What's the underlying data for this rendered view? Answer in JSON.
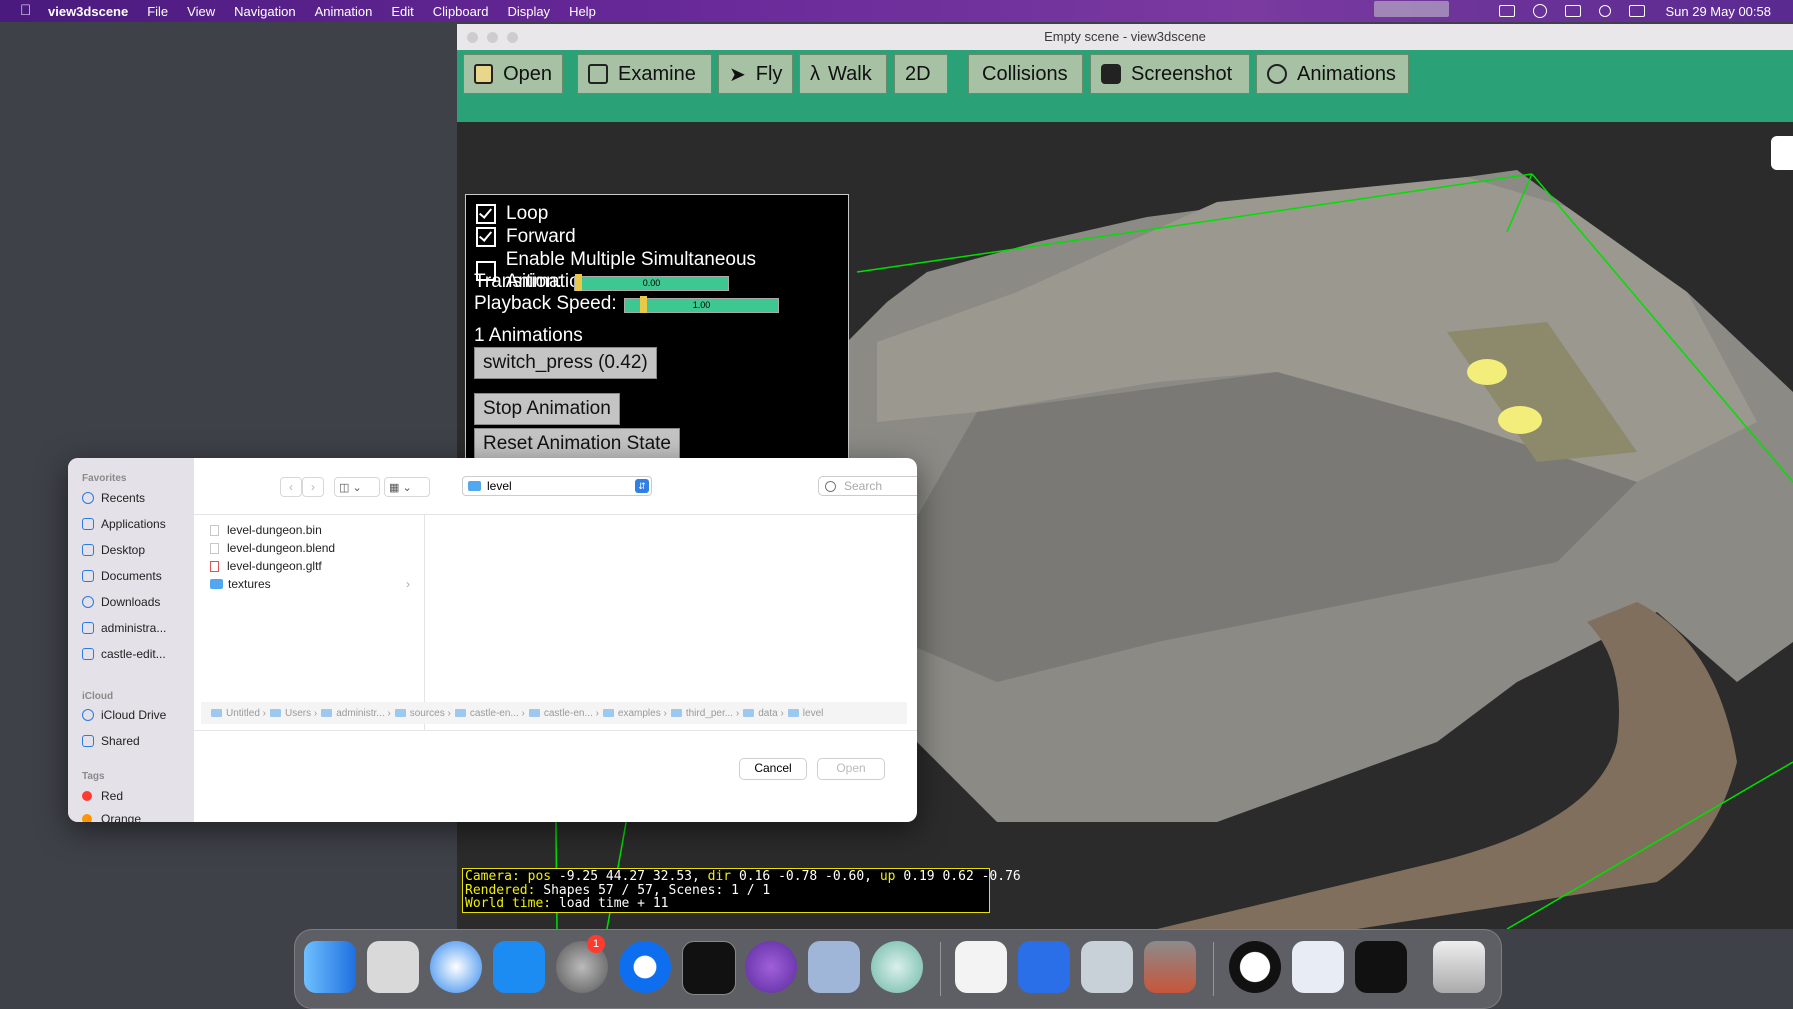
{
  "menubar": {
    "app": "view3dscene",
    "items": [
      "File",
      "View",
      "Navigation",
      "Animation",
      "Edit",
      "Clipboard",
      "Display",
      "Help"
    ],
    "clock": "Sun 29 May  00:58"
  },
  "window": {
    "title": "Empty scene - view3dscene",
    "toolbar": [
      "Open",
      "Examine",
      "Fly",
      "Walk",
      "2D",
      "Collisions",
      "Screenshot",
      "Animations"
    ]
  },
  "anim_panel": {
    "loop_label": "Loop",
    "loop_checked": true,
    "forward_label": "Forward",
    "forward_checked": true,
    "multiple_label": "Enable Multiple Simultaneous Animations",
    "multiple_checked": false,
    "transition_label": "Transition:",
    "transition_value": "0.00",
    "transition_fraction": 0.0,
    "speed_label": "Playback Speed:",
    "speed_value": "1.00",
    "speed_fraction": 0.1,
    "count_label": "1 Animations",
    "animation_button": "switch_press (0.42)",
    "stop_button": "Stop Animation",
    "reset_button": "Reset Animation State"
  },
  "status": {
    "line1_a": "Camera: pos",
    "line1_b": " -9.25 44.27 32.53, ",
    "line1_c": "dir",
    "line1_d": " 0.16 -0.78 -0.60, ",
    "line1_e": "up",
    "line1_f": " 0.19 0.62 -0.76",
    "line2_a": "Rendered:",
    "line2_b": " Shapes 57 / 57, Scenes: 1 / 1",
    "line3_a": "World time:",
    "line3_b": " load time + 11"
  },
  "dialog": {
    "favorites_head": "Favorites",
    "favorites": [
      "Recents",
      "Applications",
      "Desktop",
      "Documents",
      "Downloads",
      "administra...",
      "castle-edit..."
    ],
    "icloud_head": "iCloud",
    "icloud": [
      "iCloud Drive",
      "Shared"
    ],
    "tags_head": "Tags",
    "tags": [
      {
        "label": "Red",
        "color": "#ff3b30"
      },
      {
        "label": "Orange",
        "color": "#ff9500"
      }
    ],
    "location": "level",
    "search_placeholder": "Search",
    "files": [
      "level-dungeon.bin",
      "level-dungeon.blend",
      "level-dungeon.gltf",
      "textures"
    ],
    "breadcrumbs": [
      "Untitled",
      "Users",
      "administr...",
      "sources",
      "castle-en...",
      "castle-en...",
      "examples",
      "third_per...",
      "data",
      "level"
    ],
    "cancel": "Cancel",
    "open": "Open"
  },
  "dock": {
    "badge": "1"
  }
}
